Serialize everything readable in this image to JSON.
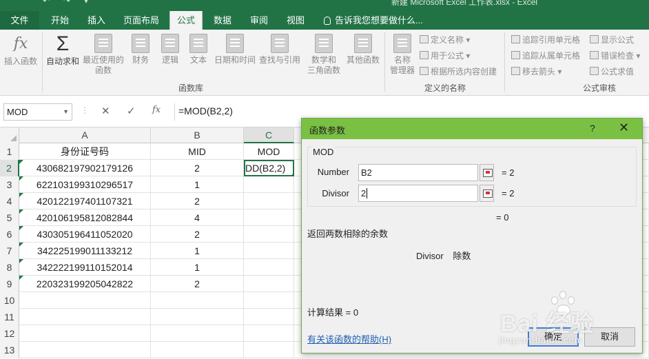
{
  "window": {
    "title": "新建 Microsoft Excel 工作表.xlsx - Excel"
  },
  "tabs": [
    {
      "label": "文件",
      "active": false
    },
    {
      "label": "开始",
      "active": false
    },
    {
      "label": "插入",
      "active": false
    },
    {
      "label": "页面布局",
      "active": false
    },
    {
      "label": "公式",
      "active": true
    },
    {
      "label": "数据",
      "active": false
    },
    {
      "label": "审阅",
      "active": false
    },
    {
      "label": "视图",
      "active": false
    }
  ],
  "tell_me": "告诉我您想要做什么...",
  "ribbon": {
    "insert_function": "插入函数",
    "autosum": "自动求和",
    "recently_used": [
      "最近使用的",
      "函数"
    ],
    "financial": "财务",
    "logical": "逻辑",
    "text": "文本",
    "date_time": "日期和时间",
    "lookup": "查找与引用",
    "math": [
      "数学和",
      "三角函数"
    ],
    "more": "其他函数",
    "group_library": "函数库",
    "name_manager": [
      "名称",
      "管理器"
    ],
    "define_name": "定义名称",
    "use_in_formula": "用于公式",
    "create_from_selection": "根据所选内容创建",
    "group_names": "定义的名称",
    "trace_precedents": "追踪引用单元格",
    "trace_dependents": "追踪从属单元格",
    "remove_arrows": "移去箭头",
    "show_formulas": "显示公式",
    "error_checking": "错误检查",
    "evaluate_formula": "公式求值",
    "group_audit": "公式审核"
  },
  "formula_bar": {
    "name_box": "MOD",
    "fx_label": "fx",
    "formula": "=MOD(B2,2)"
  },
  "sheet": {
    "columns": [
      "A",
      "B",
      "C"
    ],
    "rows": [
      {
        "n": "1",
        "a": "身份证号码",
        "b": "MID",
        "c": "MOD",
        "tri": false
      },
      {
        "n": "2",
        "a": "430682197902179126",
        "b": "2",
        "c": "DD(B2,2)",
        "tri": true
      },
      {
        "n": "3",
        "a": "622103199310296517",
        "b": "1",
        "c": "",
        "tri": true
      },
      {
        "n": "4",
        "a": "420122197401107321",
        "b": "2",
        "c": "",
        "tri": true
      },
      {
        "n": "5",
        "a": "420106195812082844",
        "b": "4",
        "c": "",
        "tri": true
      },
      {
        "n": "6",
        "a": "430305196411052020",
        "b": "2",
        "c": "",
        "tri": true
      },
      {
        "n": "7",
        "a": "342225199011133212",
        "b": "1",
        "c": "",
        "tri": true
      },
      {
        "n": "8",
        "a": "342222199110152014",
        "b": "1",
        "c": "",
        "tri": true
      },
      {
        "n": "9",
        "a": "220323199205042822",
        "b": "2",
        "c": "",
        "tri": true
      },
      {
        "n": "10",
        "a": "",
        "b": "",
        "c": "",
        "tri": false
      },
      {
        "n": "11",
        "a": "",
        "b": "",
        "c": "",
        "tri": false
      },
      {
        "n": "12",
        "a": "",
        "b": "",
        "c": "",
        "tri": false
      },
      {
        "n": "13",
        "a": "",
        "b": "",
        "c": "",
        "tri": false
      }
    ]
  },
  "dialog": {
    "title": "函数参数",
    "help_glyph": "?",
    "close_glyph": "✕",
    "function_name": "MOD",
    "number_label": "Number",
    "number_value": "B2",
    "number_result": "=  2",
    "divisor_label": "Divisor",
    "divisor_value": "2",
    "divisor_result": "=  2",
    "result_eq": "=  0",
    "description": "返回两数相除的余数",
    "arg_desc_name": "Divisor",
    "arg_desc_text": "除数",
    "calc_result": "计算结果 =   0",
    "help_link": "有关该函数的帮助(H)",
    "ok": "确定",
    "cancel": "取消"
  },
  "watermark": {
    "brand": "Bai  经验",
    "url": "jingyan.baidu.com"
  }
}
